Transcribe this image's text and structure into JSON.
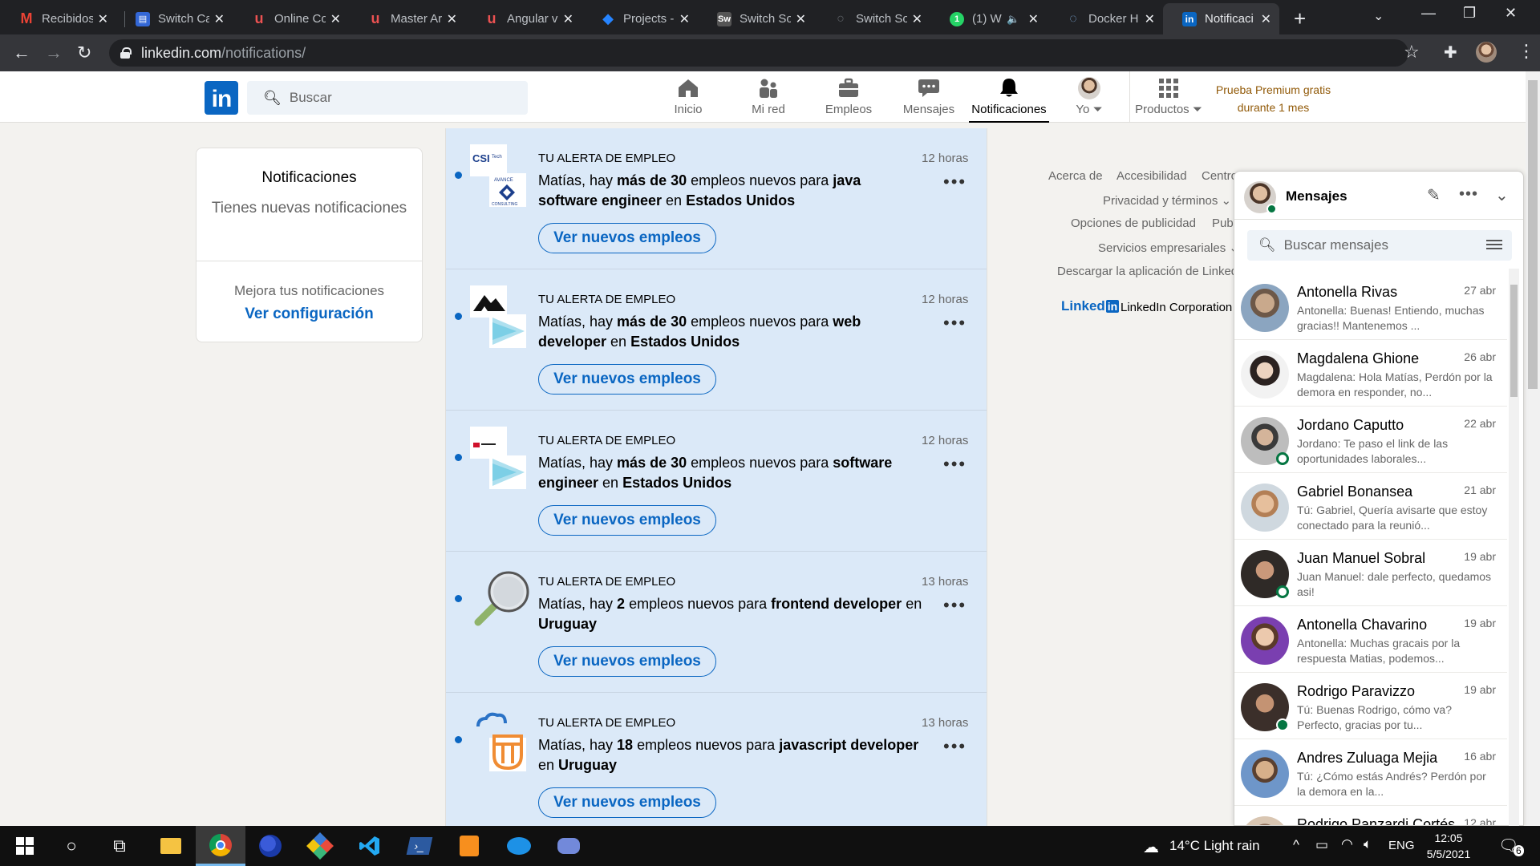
{
  "browser": {
    "tabs": [
      {
        "title": "Recibidos",
        "fav_color": "#ea4335",
        "fav_text": "M"
      },
      {
        "title": "Switch Ca",
        "fav_color": "#3367d6",
        "fav_text": "▤"
      },
      {
        "title": "Online Co",
        "fav_color": "#202124",
        "fav_text": "u"
      },
      {
        "title": "Master Ar",
        "fav_color": "#202124",
        "fav_text": "u"
      },
      {
        "title": "Angular v",
        "fav_color": "#202124",
        "fav_text": "u"
      },
      {
        "title": "Projects -",
        "fav_color": "#2684ff",
        "fav_text": "◆"
      },
      {
        "title": "Switch So",
        "fav_color": "#555555",
        "fav_text": "Sw"
      },
      {
        "title": "Switch So",
        "fav_color": "#202124",
        "fav_text": "○"
      },
      {
        "title": "(1) W",
        "fav_color": "#25d366",
        "fav_text": "1"
      },
      {
        "title": "Docker H",
        "fav_color": "#202124",
        "fav_text": "◌"
      },
      {
        "title": "Notificaci",
        "fav_color": "#0a66c2",
        "fav_text": "in"
      }
    ],
    "new_tab": "+",
    "url_host": "linkedin.com",
    "url_path": "/notifications/"
  },
  "header": {
    "search_placeholder": "Buscar",
    "nav": [
      {
        "label": "Inicio",
        "icon": "home-icon"
      },
      {
        "label": "Mi red",
        "icon": "network-icon"
      },
      {
        "label": "Empleos",
        "icon": "briefcase-icon"
      },
      {
        "label": "Mensajes",
        "icon": "chat-icon"
      },
      {
        "label": "Notificaciones",
        "icon": "bell-icon"
      },
      {
        "label": "Yo",
        "icon": "avatar-icon"
      },
      {
        "label": "Productos",
        "icon": "grid-icon"
      }
    ],
    "premium_line1": "Prueba Premium gratis",
    "premium_line2": "durante 1 mes"
  },
  "left_card": {
    "title": "Notificaciones",
    "subtitle": "Tienes nuevas notificaciones",
    "improve": "Mejora tus notificaciones",
    "link": "Ver configuración"
  },
  "notifications": [
    {
      "tag": "TU ALERTA DE EMPLEO",
      "time": "12 horas",
      "pre": "Matías, hay ",
      "count": "más de 30",
      "mid": " empleos nuevos para ",
      "query": "java software engineer",
      "conn": " en ",
      "place": "Estados Unidos",
      "button": "Ver nuevos empleos",
      "logo": "csi-logo"
    },
    {
      "tag": "TU ALERTA DE EMPLEO",
      "time": "12 horas",
      "pre": "Matías, hay ",
      "count": "más de 30",
      "mid": " empleos nuevos para ",
      "query": "web developer",
      "conn": " en ",
      "place": "Estados Unidos",
      "button": "Ver nuevos empleos",
      "logo": "mountain-logo"
    },
    {
      "tag": "TU ALERTA DE EMPLEO",
      "time": "12 horas",
      "pre": "Matías, hay ",
      "count": "más de 30",
      "mid": " empleos nuevos para ",
      "query": "software engineer",
      "conn": " en ",
      "place": "Estados Unidos",
      "button": "Ver nuevos empleos",
      "logo": "company-logo"
    },
    {
      "tag": "TU ALERTA DE EMPLEO",
      "time": "13 horas",
      "pre": "Matías, hay ",
      "count": "2",
      "mid": " empleos nuevos para ",
      "query": "frontend developer",
      "conn": " en ",
      "place": "Uruguay",
      "button": "Ver nuevos empleos",
      "logo": "magnifier-logo"
    },
    {
      "tag": "TU ALERTA DE EMPLEO",
      "time": "13 horas",
      "pre": "Matías, hay ",
      "count": "18",
      "mid": " empleos nuevos para ",
      "query": "javascript developer",
      "conn": " en ",
      "place": "Uruguay",
      "button": "Ver nuevos empleos",
      "logo": "cloud-logo"
    }
  ],
  "footer_links": {
    "about": "Acerca de",
    "accessibility": "Accesibilidad",
    "help": "Centro",
    "privacy": "Privacidad y términos",
    "ads_options": "Opciones de publicidad",
    "ads": "Publ",
    "business": "Servicios empresariales",
    "download": "Descargar la aplicación de Linked",
    "logo_text": "Linked",
    "logo_in": "in",
    "corp": "LinkedIn Corporation"
  },
  "messaging": {
    "title": "Mensajes",
    "search_placeholder": "Buscar mensajes",
    "conversations": [
      {
        "name": "Antonella Rivas",
        "date": "27 abr",
        "preview": "Antonella: Buenas! Entiendo, muchas gracias!! Mantenemos ...",
        "status": "none",
        "avatar_bg": "#b89a7c",
        "avatar_fg": "#4a6fa5"
      },
      {
        "name": "Magdalena Ghione",
        "date": "26 abr",
        "preview": "Magdalena: Hola Matías, Perdón por la demora en responder, no...",
        "status": "none",
        "avatar_bg": "#f0f0f0",
        "avatar_fg": "#2b2220"
      },
      {
        "name": "Jordano Caputto",
        "date": "22 abr",
        "preview": "Jordano: Te paso el link de las oportunidades laborales...",
        "status": "ring",
        "avatar_bg": "#bdbdbd",
        "avatar_fg": "#3a3a3a"
      },
      {
        "name": "Gabriel Bonansea",
        "date": "21 abr",
        "preview": "Tú: Gabriel, Quería avisarte que estoy conectado para la reunió...",
        "status": "none",
        "avatar_bg": "#cfd8df",
        "avatar_fg": "#c99874"
      },
      {
        "name": "Juan Manuel Sobral",
        "date": "19 abr",
        "preview": "Juan Manuel: dale perfecto, quedamos asi!",
        "status": "ring",
        "avatar_bg": "#2f2a27",
        "avatar_fg": "#b58a6c"
      },
      {
        "name": "Antonella Chavarino",
        "date": "19 abr",
        "preview": "Antonella: Muchas gracais por la respuesta Matias, podemos...",
        "status": "none",
        "avatar_bg": "#7a3fb0",
        "avatar_fg": "#e3c1a4"
      },
      {
        "name": "Rodrigo Paravizzo",
        "date": "19 abr",
        "preview": "Tú: Buenas Rodrigo, cómo va? Perfecto, gracias por tu...",
        "status": "full",
        "avatar_bg": "#3b2f2a",
        "avatar_fg": "#c49373"
      },
      {
        "name": "Andres Zuluaga Mejia",
        "date": "16 abr",
        "preview": "Tú: ¿Cómo estás Andrés? Perdón por la demora en la...",
        "status": "none",
        "avatar_bg": "#6e96c9",
        "avatar_fg": "#d7b08a"
      },
      {
        "name": "Rodrigo Panzardi Cortés",
        "date": "12 abr",
        "preview": "",
        "status": "none",
        "avatar_bg": "#d9c6b2",
        "avatar_fg": "#8a6a55"
      }
    ]
  },
  "taskbar": {
    "weather": "14°C  Light rain",
    "lang": "ENG",
    "time": "12:05",
    "date": "5/5/2021",
    "notif_count": "6"
  },
  "colors": {
    "linkedin_blue": "#0a66c2",
    "notif_bg": "#dbe9f8",
    "premium": "#915907",
    "online": "#057642"
  }
}
